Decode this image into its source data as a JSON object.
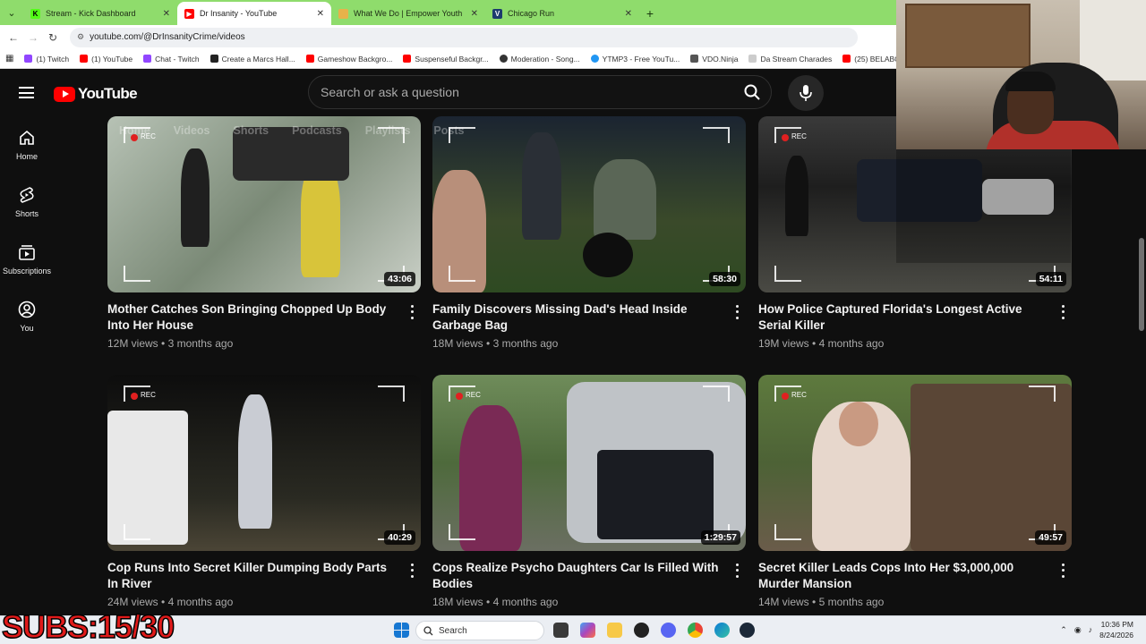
{
  "browser": {
    "tabs": [
      {
        "title": "Stream - Kick Dashboard",
        "icon": "kick-icon",
        "color": "#53fc18",
        "active": false
      },
      {
        "title": "Dr Insanity - YouTube",
        "icon": "youtube-icon",
        "color": "#ff0000",
        "active": true
      },
      {
        "title": "What We Do | Empower Youth",
        "icon": "empower-icon",
        "color": "#e7b24a",
        "active": false
      },
      {
        "title": "Chicago Run",
        "icon": "chicago-run-icon",
        "color": "#1d3b6e",
        "active": false
      }
    ],
    "url": "youtube.com/@DrInsanityCrime/videos",
    "bookmarks": [
      {
        "label": "(1) Twitch",
        "color": "#9146ff"
      },
      {
        "label": "(1) YouTube",
        "color": "#ff0000"
      },
      {
        "label": "Chat - Twitch",
        "color": "#9146ff"
      },
      {
        "label": "Create a Marcs Hall...",
        "color": "#222222"
      },
      {
        "label": "Gameshow Backgro...",
        "color": "#ff0000"
      },
      {
        "label": "Suspenseful Backgr...",
        "color": "#ff0000"
      },
      {
        "label": "Moderation - Song...",
        "color": "#333333"
      },
      {
        "label": "YTMP3 - Free YouTu...",
        "color": "#2196f3"
      },
      {
        "label": "VDO.Ninja",
        "color": "#555555"
      },
      {
        "label": "Da Stream Charades",
        "color": "#888888"
      },
      {
        "label": "(25) BELABOX CLOU...",
        "color": "#ff0000"
      }
    ]
  },
  "youtube": {
    "logo_text": "YouTube",
    "search_placeholder": "Search or ask a question",
    "sidebar": [
      {
        "label": "Home",
        "icon": "home-icon"
      },
      {
        "label": "Shorts",
        "icon": "shorts-icon"
      },
      {
        "label": "Subscriptions",
        "icon": "subscriptions-icon"
      },
      {
        "label": "You",
        "icon": "you-icon"
      }
    ],
    "channel_tabs": [
      "Home",
      "Videos",
      "Shorts",
      "Podcasts",
      "Playlists",
      "Posts"
    ],
    "videos": [
      {
        "title": "Mother Catches Son Bringing Chopped Up Body Into Her House",
        "views": "12M views",
        "age": "3 months ago",
        "duration": "43:06",
        "bg": "#8d9a8a"
      },
      {
        "title": "Family Discovers Missing Dad's Head Inside Garbage Bag",
        "views": "18M views",
        "age": "3 months ago",
        "duration": "58:30",
        "bg": "#2d3a2b"
      },
      {
        "title": "How Police Captured Florida's Longest Active Serial Killer",
        "views": "19M views",
        "age": "4 months ago",
        "duration": "54:11",
        "bg": "#232323"
      },
      {
        "title": "Cop Runs Into Secret Killer Dumping Body Parts In River",
        "views": "24M views",
        "age": "4 months ago",
        "duration": "40:29",
        "bg": "#1a1a1a"
      },
      {
        "title": "Cops Realize Psycho Daughters Car Is Filled With Bodies",
        "views": "18M views",
        "age": "4 months ago",
        "duration": "1:29:57",
        "bg": "#4b5e3c"
      },
      {
        "title": "Secret Killer Leads Cops Into Her $3,000,000 Murder Mansion",
        "views": "14M views",
        "age": "5 months ago",
        "duration": "49:57",
        "bg": "#5f6e4a"
      }
    ],
    "rec_label": "REC"
  },
  "overlay": {
    "subs_text": "SUBS:15/30"
  },
  "taskbar": {
    "search_label": "Search",
    "time": "10:36 PM",
    "date": "8/24/2026"
  }
}
